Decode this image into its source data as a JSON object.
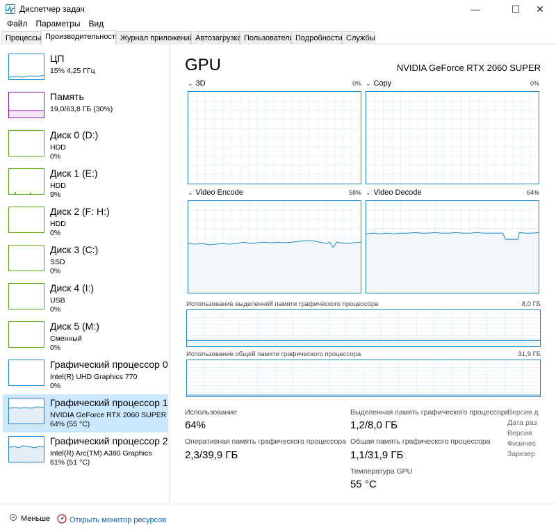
{
  "window": {
    "title": "Диспетчер задач",
    "icon": "task-manager-icon",
    "controls": [
      "minimize-icon",
      "maximize-icon",
      "close-icon"
    ]
  },
  "menu": [
    "Файл",
    "Параметры",
    "Вид"
  ],
  "tabs": [
    "Процессы",
    "Производительность",
    "Журнал приложений",
    "Автозагрузка",
    "Пользователи",
    "Подробности",
    "Службы"
  ],
  "active_tab": "Производительность",
  "sidebar": {
    "items": [
      {
        "title": "ЦП",
        "line1": "15% 4,25 ГГц",
        "line2": "",
        "color": "#1a86c9",
        "level": 0.15
      },
      {
        "title": "Память",
        "line1": "19,0/63,8 ГБ (30%)",
        "line2": "",
        "color": "#8b12ae",
        "level": 0.3
      },
      {
        "title": "Диск 0 (D:)",
        "line1": "HDD",
        "line2": "0%",
        "color": "#4da60c",
        "level": 0.0
      },
      {
        "title": "Диск 1 (E:)",
        "line1": "HDD",
        "line2": "9%",
        "color": "#4da60c",
        "level": 0.09
      },
      {
        "title": "Диск 2 (F: H:)",
        "line1": "HDD",
        "line2": "0%",
        "color": "#4da60c",
        "level": 0.0
      },
      {
        "title": "Диск 3 (C:)",
        "line1": "SSD",
        "line2": "0%",
        "color": "#4da60c",
        "level": 0.0
      },
      {
        "title": "Диск 4 (I:)",
        "line1": "USB",
        "line2": "0%",
        "color": "#4da60c",
        "level": 0.0
      },
      {
        "title": "Диск 5 (M:)",
        "line1": "Сменный",
        "line2": "0%",
        "color": "#4da60c",
        "level": 0.0
      },
      {
        "title": "Графический процессор 0",
        "line1": "Intel(R) UHD Graphics 770",
        "line2": "0%",
        "color": "#1a86c9",
        "level": 0.0
      },
      {
        "title": "Графический процессор 1",
        "line1": "NVIDIA GeForce RTX 2060 SUPER",
        "line2": "64% (55 °C)",
        "color": "#1a86c9",
        "level": 0.64
      },
      {
        "title": "Графический процессор 2",
        "line1": "Intel(R) Arc(TM) A380 Graphics",
        "line2": "61% (51 °C)",
        "color": "#1a86c9",
        "level": 0.61
      }
    ],
    "selected_index": 9
  },
  "main": {
    "title": "GPU",
    "device_name": "NVIDIA GeForce RTX 2060 SUPER",
    "engines": [
      {
        "name": "3D",
        "percent": "0%"
      },
      {
        "name": "Copy",
        "percent": "0%"
      },
      {
        "name": "Video Encode",
        "percent": "58%"
      },
      {
        "name": "Video Decode",
        "percent": "64%"
      }
    ],
    "dedicated_memory": {
      "label": "Использование выделенной памяти графического процессора",
      "max": "8,0 ГБ"
    },
    "shared_memory": {
      "label": "Использование общей памяти графического процессора",
      "max": "31,9 ГБ"
    },
    "stats": {
      "usage_label": "Использование",
      "usage_value": "64%",
      "dedicated_label": "Выделенная память графического процессора",
      "dedicated_value": "1,2/8,0 ГБ",
      "gpu_ram_label": "Оперативная память графического процессора",
      "gpu_ram_value": "2,3/39,9 ГБ",
      "shared_label": "Общая память графического процессора",
      "shared_value": "1,1/31,9 ГБ",
      "temp_label": "Температура GPU",
      "temp_value": "55 °C"
    },
    "side_labels": [
      "Версия д",
      "Дата раз",
      "Версия",
      "Физичес",
      "Зарезер"
    ]
  },
  "footer": {
    "fewer_label": "Меньше",
    "monitor_link": "Открыть монитор ресурсов"
  },
  "colors": {
    "accent": "#1a86c9",
    "graph_fill": "#f1f6fa",
    "selection": "#cce8ff",
    "link": "#0e63b5"
  }
}
